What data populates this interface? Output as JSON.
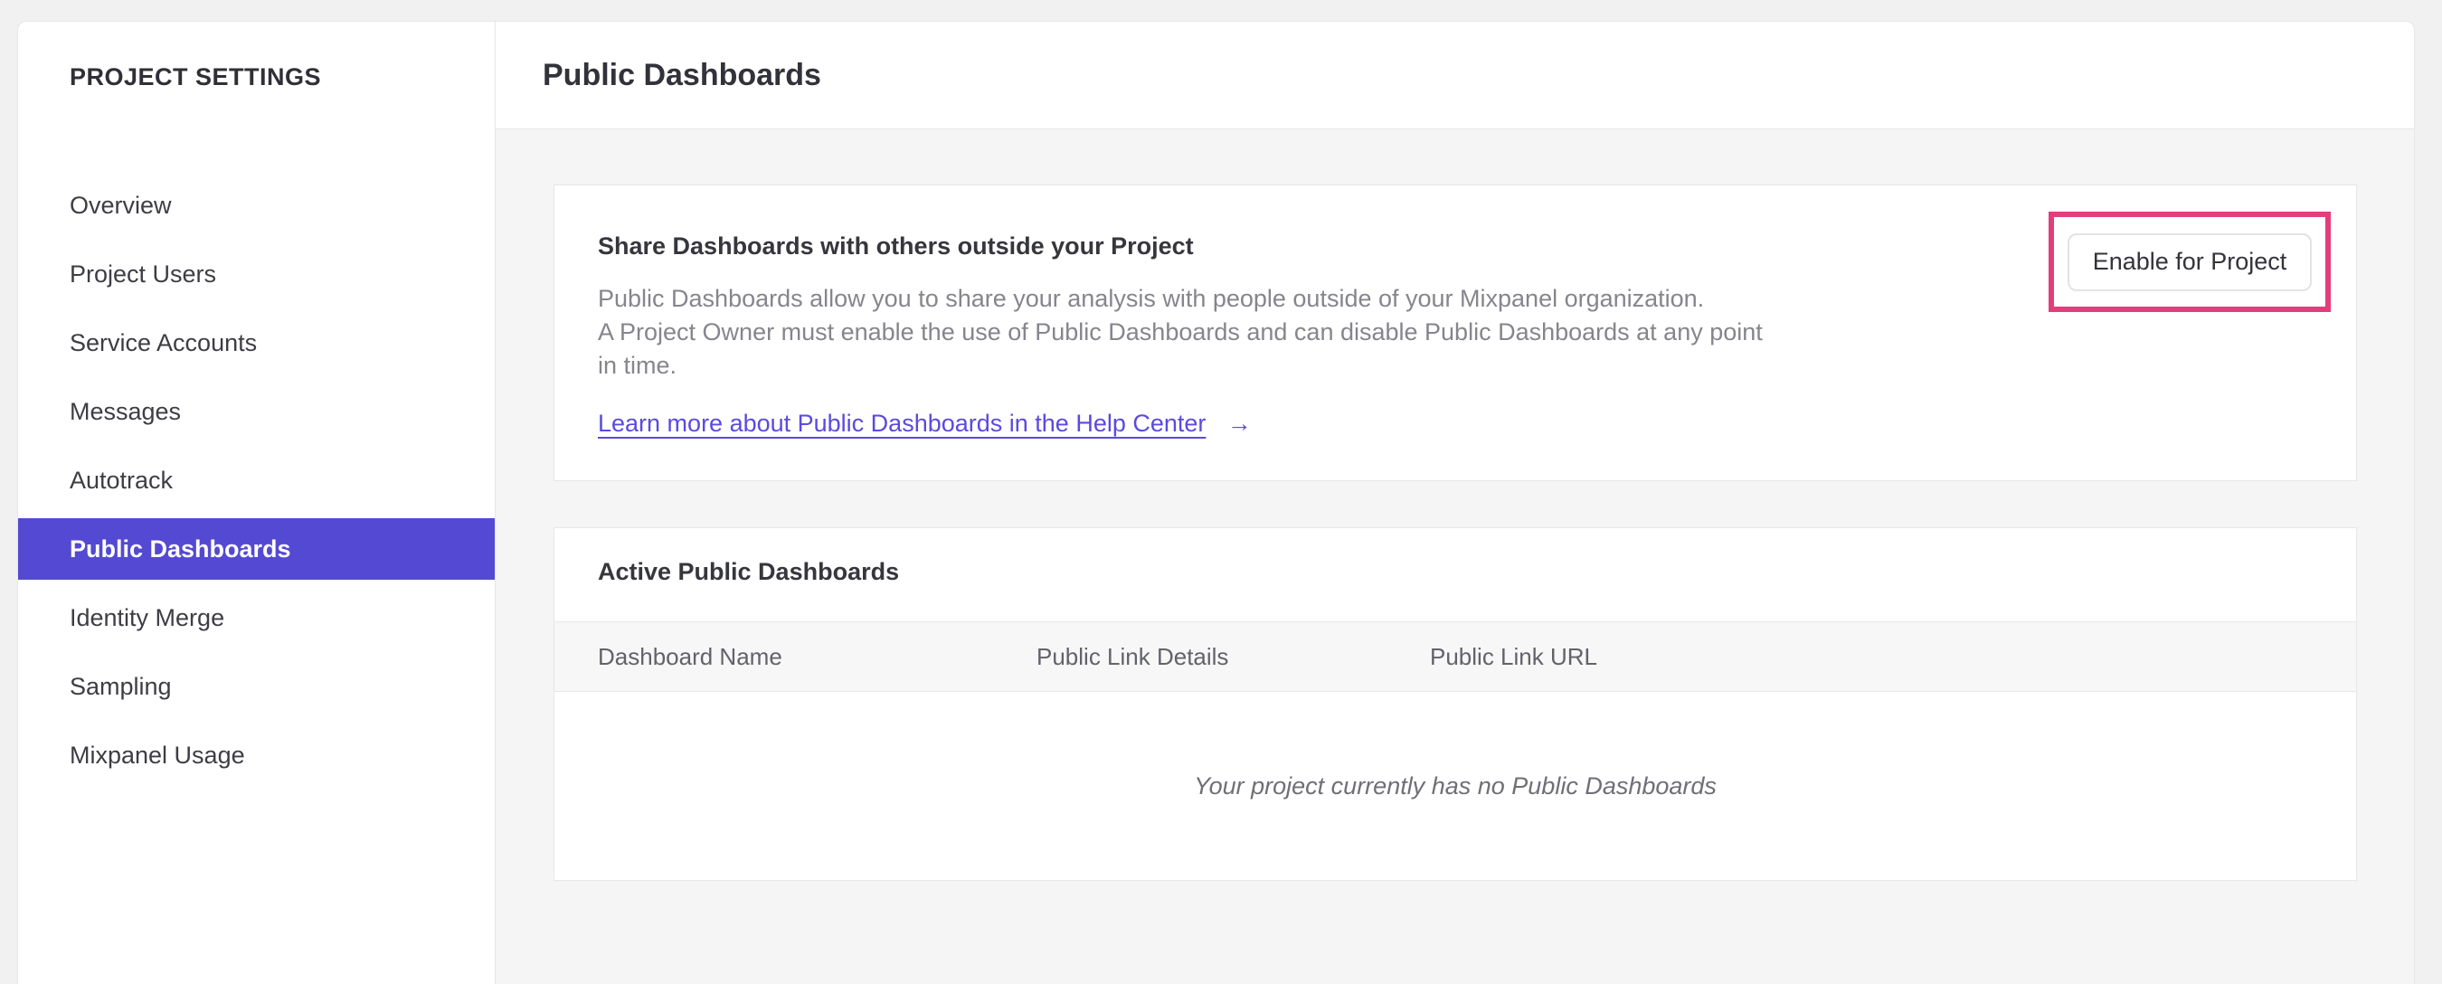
{
  "colors": {
    "accent": "#5449d2",
    "link": "#5a4ae0",
    "annotation": "#e23e7d",
    "heading": "#32323a",
    "body-text": "#85858c",
    "page-bg": "#f1f1f2",
    "panel-bg": "#f5f5f6",
    "card-border": "#e7e7ea"
  },
  "sidebar": {
    "title": "PROJECT SETTINGS",
    "items": [
      {
        "label": "Overview",
        "selected": false
      },
      {
        "label": "Project Users",
        "selected": false
      },
      {
        "label": "Service Accounts",
        "selected": false
      },
      {
        "label": "Messages",
        "selected": false
      },
      {
        "label": "Autotrack",
        "selected": false
      },
      {
        "label": "Public Dashboards",
        "selected": true
      },
      {
        "label": "Identity Merge",
        "selected": false
      },
      {
        "label": "Sampling",
        "selected": false
      },
      {
        "label": "Mixpanel Usage",
        "selected": false
      }
    ]
  },
  "header": {
    "title": "Public Dashboards"
  },
  "share_card": {
    "title": "Share Dashboards with others outside your Project",
    "description_lines": [
      "Public Dashboards allow you to share your analysis with people outside of your Mixpanel organization.",
      "A Project Owner must enable the use of Public Dashboards and can disable Public Dashboards at any point",
      "in time."
    ],
    "link_label": "Learn more about Public Dashboards in the Help Center",
    "link_arrow": "→",
    "button_label": "Enable for Project"
  },
  "active_card": {
    "title": "Active Public Dashboards",
    "columns": [
      "Dashboard Name",
      "Public Link Details",
      "Public Link URL"
    ],
    "rows": [],
    "empty_message": "Your project currently has no Public Dashboards"
  }
}
